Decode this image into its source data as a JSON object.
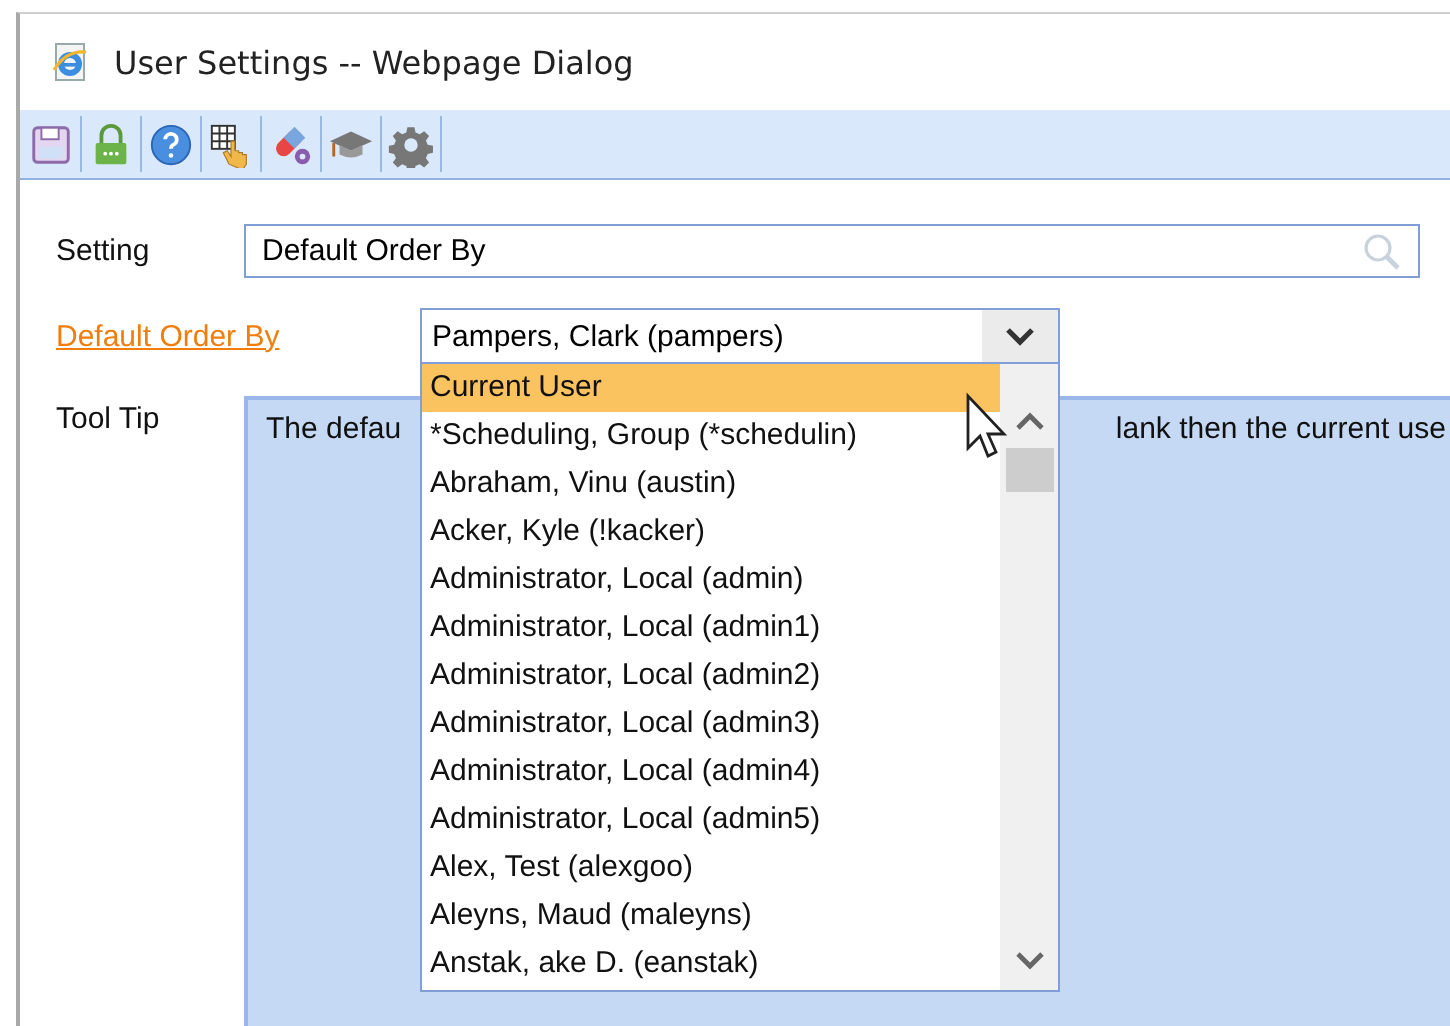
{
  "window": {
    "title": "User Settings -- Webpage Dialog"
  },
  "form": {
    "setting_label": "Setting",
    "setting_value": "Default Order By",
    "field_label": "Default Order By",
    "select_value": "Pampers, Clark (pampers)",
    "tooltip_label": "Tool Tip",
    "tooltip_text_start": "The defau",
    "tooltip_text_end": "lank then the current use"
  },
  "dropdown": {
    "options": [
      {
        "label": "Current User",
        "selected": true
      },
      {
        "label": "*Scheduling, Group (*schedulin)",
        "selected": false
      },
      {
        "label": "Abraham, Vinu (austin)",
        "selected": false
      },
      {
        "label": "Acker, Kyle (!kacker)",
        "selected": false
      },
      {
        "label": "Administrator, Local (admin)",
        "selected": false
      },
      {
        "label": "Administrator, Local (admin1)",
        "selected": false
      },
      {
        "label": "Administrator, Local (admin2)",
        "selected": false
      },
      {
        "label": "Administrator, Local (admin3)",
        "selected": false
      },
      {
        "label": "Administrator, Local (admin4)",
        "selected": false
      },
      {
        "label": "Administrator, Local (admin5)",
        "selected": false
      },
      {
        "label": "Alex, Test (alexgoo)",
        "selected": false
      },
      {
        "label": "Aleyns, Maud (maleyns)",
        "selected": false
      },
      {
        "label": "Anstak, ake D. (eanstak)",
        "selected": false
      }
    ]
  }
}
